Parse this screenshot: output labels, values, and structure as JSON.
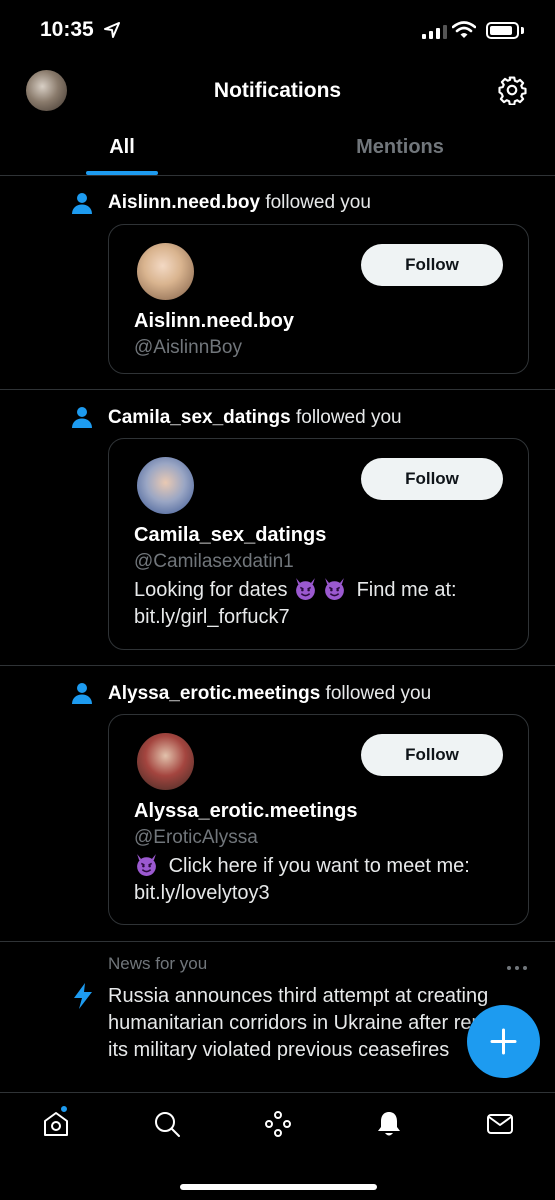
{
  "status_bar": {
    "time": "10:35"
  },
  "header": {
    "title": "Notifications"
  },
  "tabs": [
    {
      "label": "All",
      "active": true
    },
    {
      "label": "Mentions",
      "active": false
    }
  ],
  "notifications": [
    {
      "username": "Aislinn.need.boy",
      "action": "followed you",
      "card": {
        "display_name": "Aislinn.need.boy",
        "handle": "@AislinnBoy",
        "follow_label": "Follow",
        "bio": null
      }
    },
    {
      "username": "Camila_sex_datings",
      "action": "followed you",
      "card": {
        "display_name": "Camila_sex_datings",
        "handle": "@Camilasexdatin1",
        "follow_label": "Follow",
        "bio_line1_a": "Looking for dates",
        "bio_line1_b": "Find me at:",
        "bio_line2": "bit.ly/girl_forfuck7"
      }
    },
    {
      "username": "Alyssa_erotic.meetings",
      "action": "followed you",
      "card": {
        "display_name": "Alyssa_erotic.meetings",
        "handle": "@EroticAlyssa",
        "follow_label": "Follow",
        "bio_line1": "Click here if you want to meet me:",
        "bio_line2": "bit.ly/lovelytoy3"
      }
    }
  ],
  "news": {
    "label": "News for you",
    "headline": "Russia announces third attempt at creating humanitarian corridors in Ukraine after reports its military violated previous ceasefires"
  },
  "colors": {
    "accent": "#1d9bf0",
    "background": "#000000",
    "secondary_text": "#71767b",
    "divider": "#2f3336"
  },
  "icons": {
    "status": [
      "location-arrow-icon",
      "signal-icon",
      "wifi-icon",
      "battery-icon"
    ],
    "header": [
      "gear-icon"
    ],
    "notification": [
      "person-icon",
      "devil-emoji-icon",
      "bolt-icon",
      "more-icon"
    ],
    "fab": "plus-icon",
    "bottom_nav": [
      "home-icon",
      "search-icon",
      "spaces-icon",
      "bell-icon",
      "mail-icon"
    ]
  }
}
